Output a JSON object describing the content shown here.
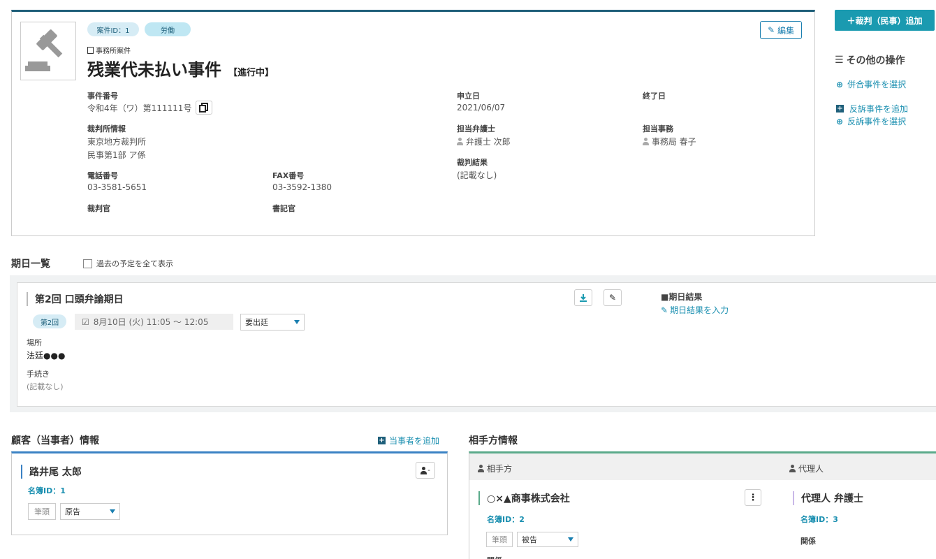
{
  "case": {
    "id_badge": "案件ID：1",
    "category_badge": "労働",
    "office_case_label": "事務所案件",
    "title": "残業代未払い事件",
    "status": "【進行中】",
    "edit_label": "編集",
    "case_number_label": "事件番号",
    "case_number": "令和4年（ワ）第111111号",
    "filing_date_label": "申立日",
    "filing_date": "2021/06/07",
    "end_date_label": "終了日",
    "court_info_label": "裁判所情報",
    "court_name": "東京地方裁判所",
    "court_division": "民事第1部 ア係",
    "lawyer_label": "担当弁護士",
    "lawyer": "弁護士 次郎",
    "clerk_label": "担当事務",
    "clerk": "事務局 春子",
    "result_label": "裁判結果",
    "result": "(記載なし)",
    "phone_label": "電話番号",
    "phone": "03-3581-5651",
    "fax_label": "FAX番号",
    "fax": "03-3592-1380",
    "judge_label": "裁判官",
    "secretary_label": "書記官"
  },
  "sidebar": {
    "add_trial_button": "＋裁判（民事）追加",
    "other_ops_title": "その他の操作",
    "select_joined": "併合事件を選択",
    "add_counter": "反訴事件を追加",
    "select_counter": "反訴事件を選択"
  },
  "schedule": {
    "title": "期日一覧",
    "show_past_label": "過去の予定を全て表示",
    "item_title": "第2回 口頭弁論期日",
    "round_badge": "第2回",
    "datetime": "8月10日 (火) 11:05 ～ 12:05",
    "attendance_select": "要出廷",
    "place_label": "場所",
    "place": "法廷●●●",
    "procedure_label": "手続き",
    "procedure": "(記載なし)",
    "result_title": "■期日結果",
    "result_input_link": "期日結果を入力"
  },
  "client": {
    "section_title": "顧客（当事者）情報",
    "add_party_link": "当事者を追加",
    "name": "路井尾 太郎",
    "directory_id": "名簿ID：1",
    "lead_tag": "筆頭",
    "role_select": "原告"
  },
  "opponent": {
    "section_title": "相手方情報",
    "opponent_header": "相手方",
    "agent_header": "代理人",
    "name": "○×▲商事株式会社",
    "directory_id": "名簿ID：2",
    "lead_tag": "筆頭",
    "role_select": "被告",
    "relation_label": "関係",
    "agent_name": "代理人 弁護士",
    "agent_directory_id": "名簿ID：3",
    "agent_relation_label": "関係"
  },
  "colors": {
    "accent": "#1a9ab0",
    "header_border": "#1f5f7a",
    "client_border": "#3b82c4",
    "opponent_border": "#5aaa8a"
  }
}
